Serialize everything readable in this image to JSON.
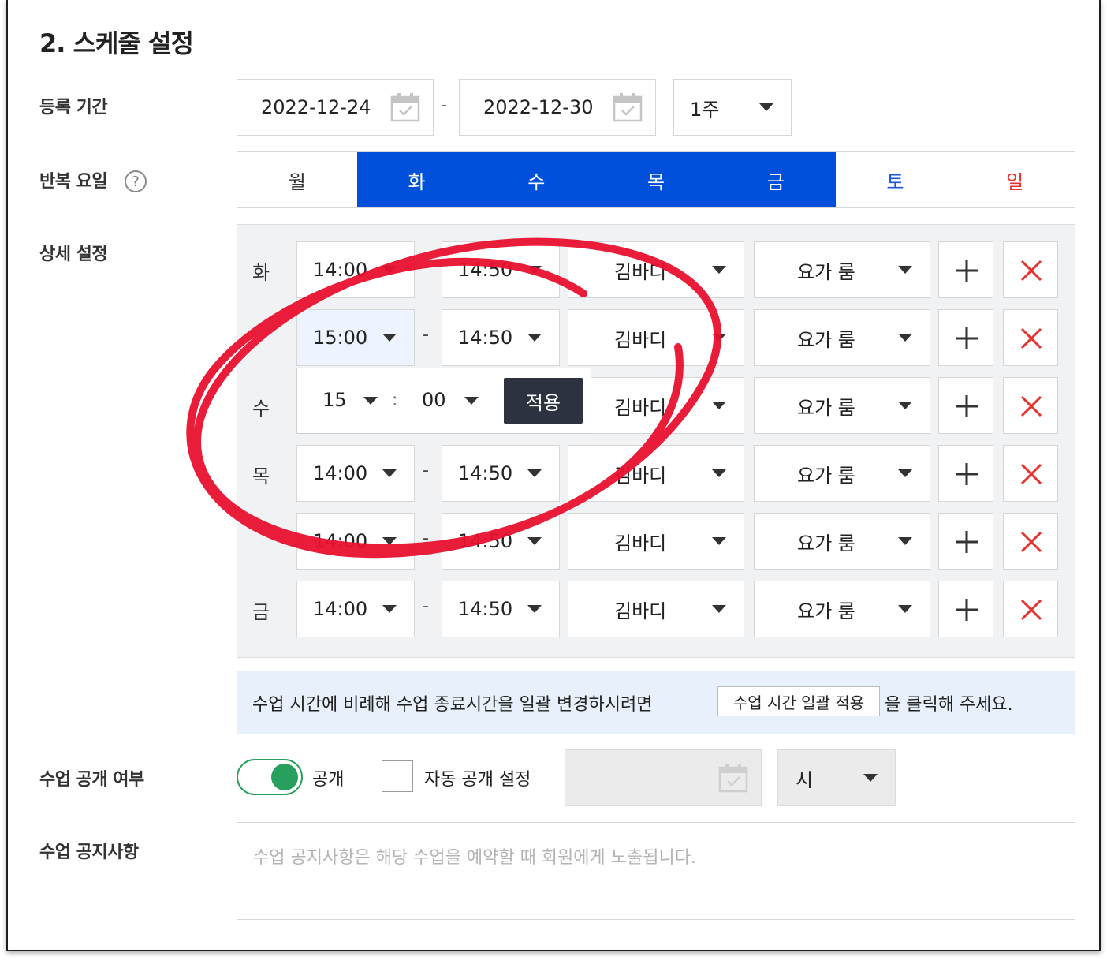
{
  "section": {
    "title": "2. 스케줄 설정"
  },
  "labels": {
    "period": "등록 기간",
    "repeat": "반복 요일",
    "detail": "상세 설정",
    "visibility": "수업 공개 여부",
    "notice": "수업 공지사항"
  },
  "period": {
    "start_date": "2022-12-24",
    "end_date": "2022-12-30",
    "separator": "-",
    "duration": "1주"
  },
  "repeat_days": [
    {
      "label": "월",
      "selected": false
    },
    {
      "label": "화",
      "selected": true
    },
    {
      "label": "수",
      "selected": true
    },
    {
      "label": "목",
      "selected": true
    },
    {
      "label": "금",
      "selected": true
    },
    {
      "label": "토",
      "selected": false
    },
    {
      "label": "일",
      "selected": false
    }
  ],
  "help_icon": {
    "glyph": "?"
  },
  "detail_rows": [
    {
      "day": "화",
      "start": "14:00",
      "end": "14:50",
      "instructor": "김바디",
      "room": "요가 룸",
      "sep": "-"
    },
    {
      "day": "",
      "start": "15:00",
      "end": "14:50",
      "instructor": "김바디",
      "room": "요가 룸",
      "sep": "-"
    },
    {
      "day": "수",
      "start": "",
      "end": "",
      "instructor": "김바디",
      "room": "요가 룸",
      "sep": ""
    },
    {
      "day": "목",
      "start": "14:00",
      "end": "14:50",
      "instructor": "김바디",
      "room": "요가 룸",
      "sep": "-"
    },
    {
      "day": "",
      "start": "14:00",
      "end": "14:50",
      "instructor": "김바디",
      "room": "요가 룸",
      "sep": "-"
    },
    {
      "day": "금",
      "start": "14:00",
      "end": "14:50",
      "instructor": "김바디",
      "room": "요가 룸",
      "sep": "-"
    }
  ],
  "time_popup": {
    "hour": "15",
    "colon": ":",
    "minute": "00",
    "apply_label": "적용"
  },
  "info": {
    "text_before": "수업 시간에 비례해 수업 종료시간을 일괄 변경하시려면",
    "button_label": "수업 시간 일괄 적용",
    "text_after": "을 클릭해 주세요."
  },
  "visibility": {
    "public_label": "공개",
    "public_on": true,
    "auto_label": "자동 공개 설정",
    "hour_unit": "시"
  },
  "notice": {
    "placeholder": "수업 공지사항은 해당 수업을 예약할 때 회원에게 노출됩니다."
  },
  "colors": {
    "selected_day": "#0050dc",
    "saturday": "#1a56e0",
    "sunday": "#e5322e",
    "toggle_on": "#27a05e",
    "delete_icon": "#e5322e",
    "annotation": "#e8102e"
  }
}
